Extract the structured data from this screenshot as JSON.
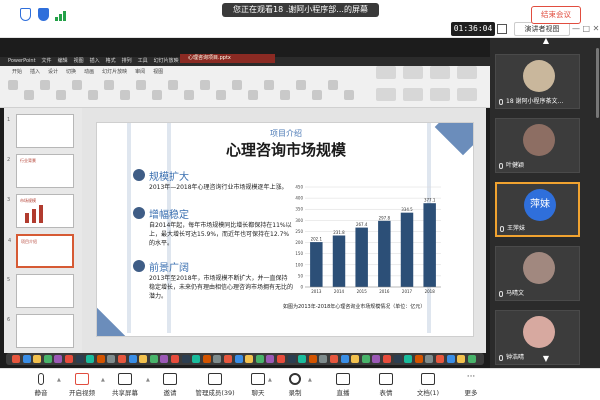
{
  "top_bar": {
    "viewing_banner": "您正在观看18 .谢阿小程序部...的屏幕",
    "timer": "01:36:04",
    "presenter_view_label": "演讲者视图",
    "window_controls": "— □ ✕"
  },
  "mac_menubar": [
    "PowerPoint",
    "文件",
    "编辑",
    "视图",
    "插入",
    "格式",
    "排列",
    "工具",
    "幻灯片放映",
    "窗口",
    "帮助"
  ],
  "ribbon_tabs": [
    "开始",
    "插入",
    "设计",
    "切换",
    "动画",
    "幻灯片放映",
    "审阅",
    "视图"
  ],
  "ppt_window_title": "心理咨询项目.pptx",
  "thumbnails": [
    {
      "num": "1",
      "title": ""
    },
    {
      "num": "2",
      "title": "行业背景"
    },
    {
      "num": "3",
      "title": "市场规模"
    },
    {
      "num": "4",
      "title": "项目介绍"
    },
    {
      "num": "5",
      "title": ""
    },
    {
      "num": "6",
      "title": ""
    }
  ],
  "slide": {
    "project_label": "项目介绍",
    "title": "心理咨询市场规模",
    "sections": [
      {
        "heading": "规模扩大",
        "body": "2013年—2018年心理咨询行业市场规模逐年上涨。",
        "icon": "tools-icon"
      },
      {
        "heading": "增幅稳定",
        "body": "自2014年起，每年市场规模同比增长都保持在11%以上，最大增长可达15.9%，而近年也可保持在12.7%的水平。",
        "icon": "growth-icon"
      },
      {
        "heading": "前景广阔",
        "body": "2013年至2018年，市场规模不断扩大，并一直保持稳定增长，未来仍有理由相信心理咨询市场拥有无比的潜力。",
        "icon": "prospect-icon"
      }
    ],
    "chart_caption": "如图为2013年-2018年心理咨询业市场规模情况（单位：亿元）"
  },
  "chart_data": {
    "type": "bar",
    "categories": [
      "2013",
      "2014",
      "2015",
      "2016",
      "2017",
      "2018"
    ],
    "values": [
      202.1,
      231.8,
      267.4,
      297.8,
      334.5,
      377.1
    ],
    "title": "",
    "xlabel": "",
    "ylabel": "",
    "ylim": [
      0,
      450
    ],
    "yticks": [
      0,
      50,
      100,
      150,
      200,
      250,
      300,
      350,
      400,
      450
    ],
    "color": "#2c4f77",
    "grid": true
  },
  "participants": [
    {
      "name": "18 谢阿小程序茶文...",
      "avatar": "dog-photo",
      "active": false
    },
    {
      "name": "叶健颖",
      "avatar": "photo",
      "active": false
    },
    {
      "name": "王萍妹",
      "avatar": "萍妹",
      "active": true
    },
    {
      "name": "马晴文",
      "avatar": "photo",
      "active": false
    },
    {
      "name": "钟浩晴",
      "avatar": "child-photo",
      "active": false
    }
  ],
  "toolbar": {
    "items": [
      {
        "label": "静音",
        "icon": "mic-icon"
      },
      {
        "label": "开启视频",
        "icon": "video-off-icon"
      },
      {
        "label": "共享屏幕",
        "icon": "share-screen-icon"
      },
      {
        "label": "邀请",
        "icon": "invite-icon"
      },
      {
        "label": "管理成员(39)",
        "icon": "members-icon"
      },
      {
        "label": "聊天",
        "icon": "chat-icon"
      },
      {
        "label": "录制",
        "icon": "record-icon"
      },
      {
        "label": "直播",
        "icon": "live-icon"
      },
      {
        "label": "表情",
        "icon": "emoji-icon"
      },
      {
        "label": "文档(1)",
        "icon": "document-icon"
      },
      {
        "label": "更多",
        "icon": "more-icon"
      }
    ],
    "end_meeting": "结束会议"
  },
  "colors": {
    "accent": "#2f6fdb",
    "end_meeting": "#e14d3f",
    "slide_title": "#1a1a1a",
    "section_heading": "#3a6fb0",
    "bar": "#2c4f77",
    "active_speaker": "#f1a330"
  }
}
